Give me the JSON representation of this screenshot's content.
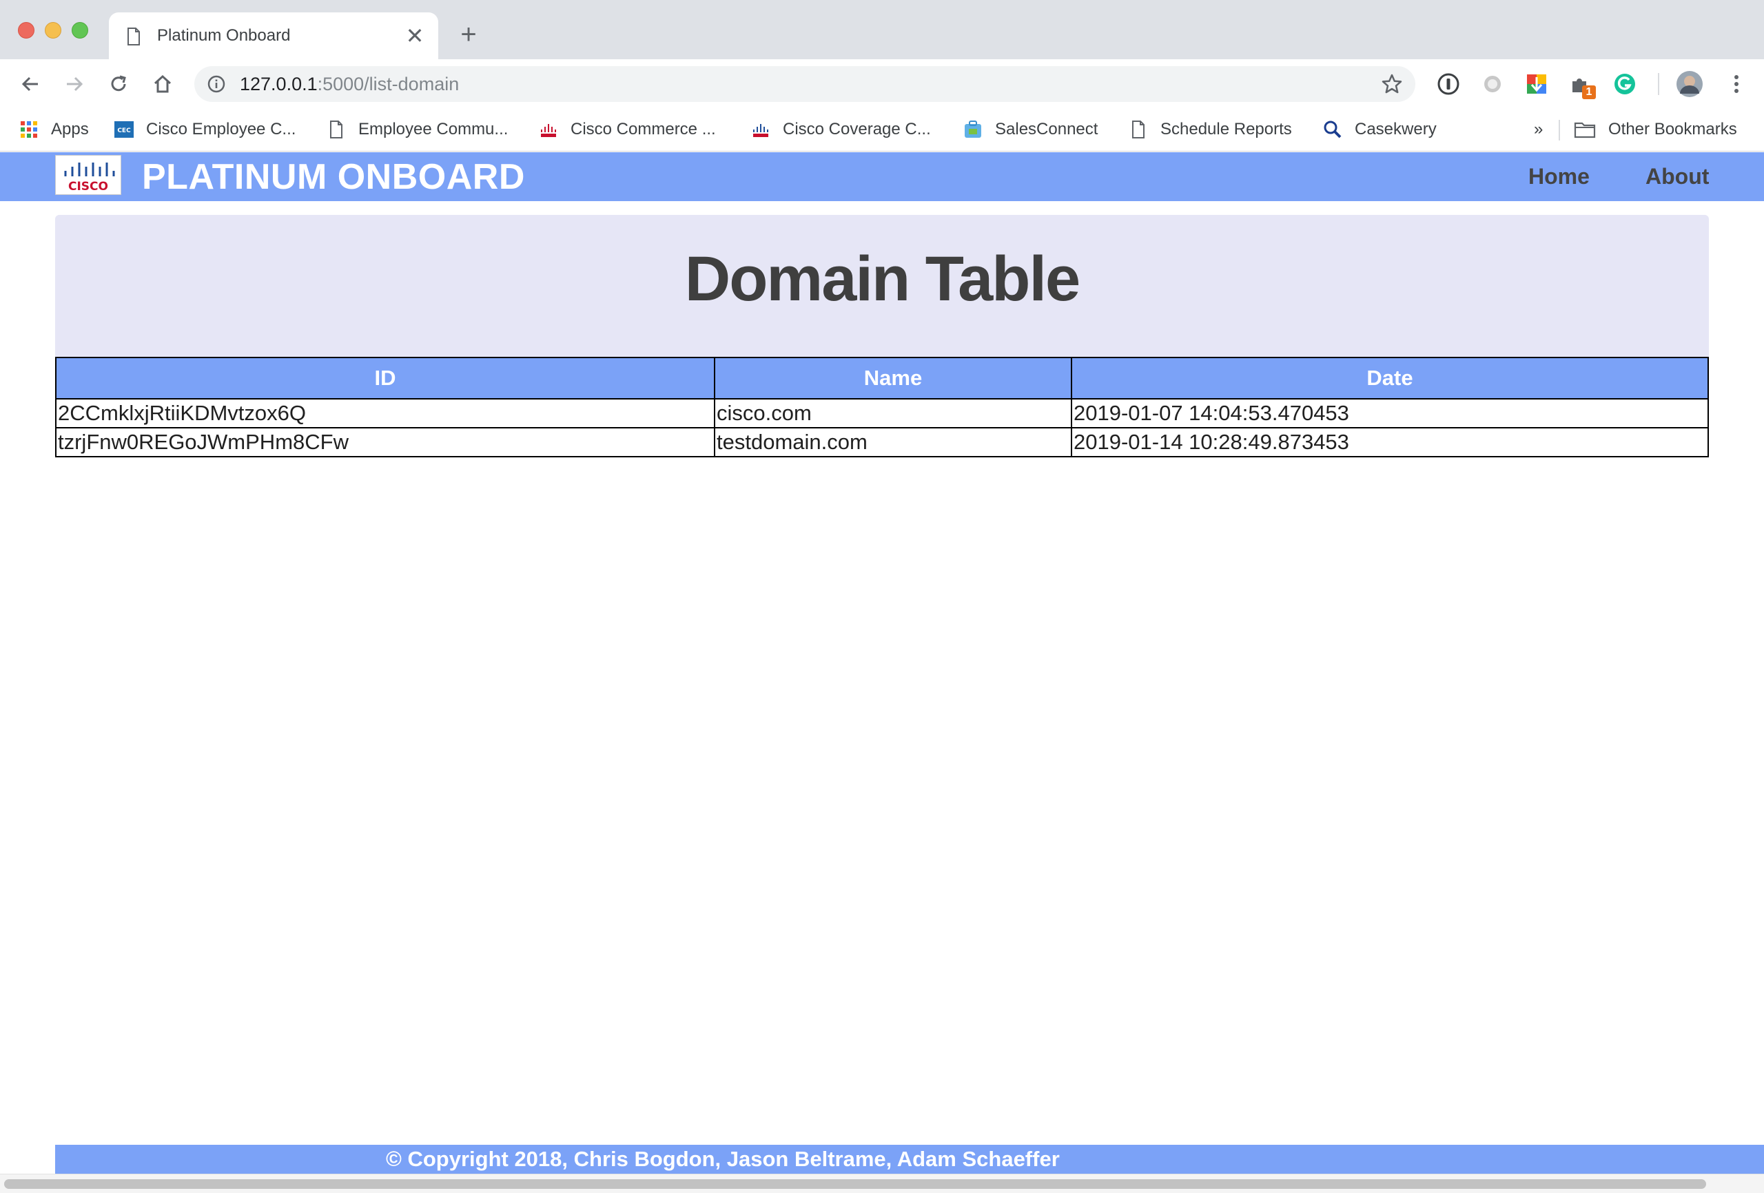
{
  "browser": {
    "tab_title": "Platinum Onboard",
    "tab_close": "✕",
    "new_tab": "+",
    "url_host": "127.0.0.1",
    "url_rest": ":5000/list-domain",
    "extension_badge": "1"
  },
  "bookmarks": {
    "items": [
      {
        "label": "Apps",
        "icon": "apps-grid-icon"
      },
      {
        "label": "Cisco Employee C...",
        "icon": "cec-icon"
      },
      {
        "label": "Employee Commu...",
        "icon": "page-icon"
      },
      {
        "label": "Cisco Commerce ...",
        "icon": "cisco-icon"
      },
      {
        "label": "Cisco Coverage C...",
        "icon": "cisco-icon"
      },
      {
        "label": "SalesConnect",
        "icon": "salesconnect-icon"
      },
      {
        "label": "Schedule Reports",
        "icon": "page-icon"
      },
      {
        "label": "Casekwery",
        "icon": "search-icon"
      }
    ],
    "overflow": "»",
    "other": "Other Bookmarks"
  },
  "navbar": {
    "logo_text": "CISCO",
    "brand": "PLATINUM ONBOARD",
    "links": [
      "Home",
      "About"
    ]
  },
  "main": {
    "title": "Domain Table",
    "table": {
      "headers": [
        "ID",
        "Name",
        "Date"
      ],
      "rows": [
        [
          "2CCmklxjRtiiKDMvtzox6Q",
          "cisco.com",
          "2019-01-07 14:04:53.470453"
        ],
        [
          "tzrjFnw0REGoJWmPHm8CFw",
          "testdomain.com",
          "2019-01-14 10:28:49.873453"
        ]
      ]
    }
  },
  "footer": {
    "text": "© Copyright 2018, Chris Bogdon, Jason Beltrame, Adam Schaeffer"
  },
  "colors": {
    "navbar": "#7ba2f7",
    "jumbotron": "#e6e6f6",
    "title_text": "#3f3f3f"
  }
}
